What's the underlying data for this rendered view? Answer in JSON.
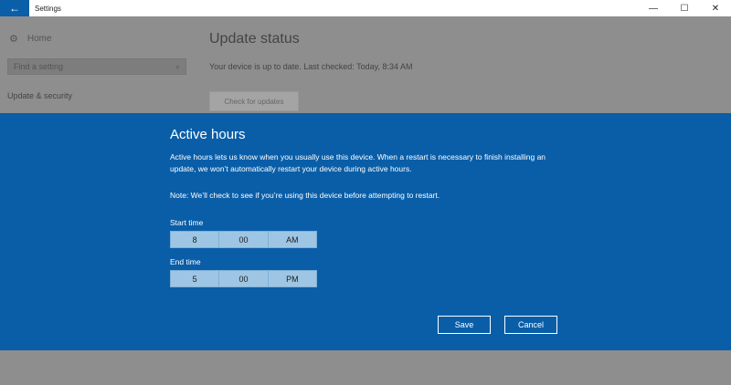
{
  "window": {
    "title": "Settings",
    "back_icon": "←",
    "minimize_icon": "—",
    "maximize_icon": "☐",
    "close_icon": "✕"
  },
  "sidebar": {
    "home_icon": "⚙",
    "home_label": "Home",
    "search_placeholder": "Find a setting",
    "search_icon": "⌕",
    "section_label": "Update & security"
  },
  "main": {
    "title": "Update status",
    "status_text": "Your device is up to date. Last checked: Today, 8:34 AM",
    "check_button": "Check for updates"
  },
  "dialog": {
    "title": "Active hours",
    "description": "Active hours lets us know when you usually use this device. When a restart is necessary to finish installing an update, we won’t automatically restart your device during active hours.",
    "note": "Note: We’ll check to see if you’re using this device before attempting to restart.",
    "start": {
      "label": "Start time",
      "hour": "8",
      "minute": "00",
      "period": "AM"
    },
    "end": {
      "label": "End time",
      "hour": "5",
      "minute": "00",
      "period": "PM"
    },
    "save_label": "Save",
    "cancel_label": "Cancel"
  },
  "colors": {
    "accent": "#0a5ea8",
    "picker_bg": "#9ec6e4",
    "dim_bg": "#8e8e8e"
  }
}
